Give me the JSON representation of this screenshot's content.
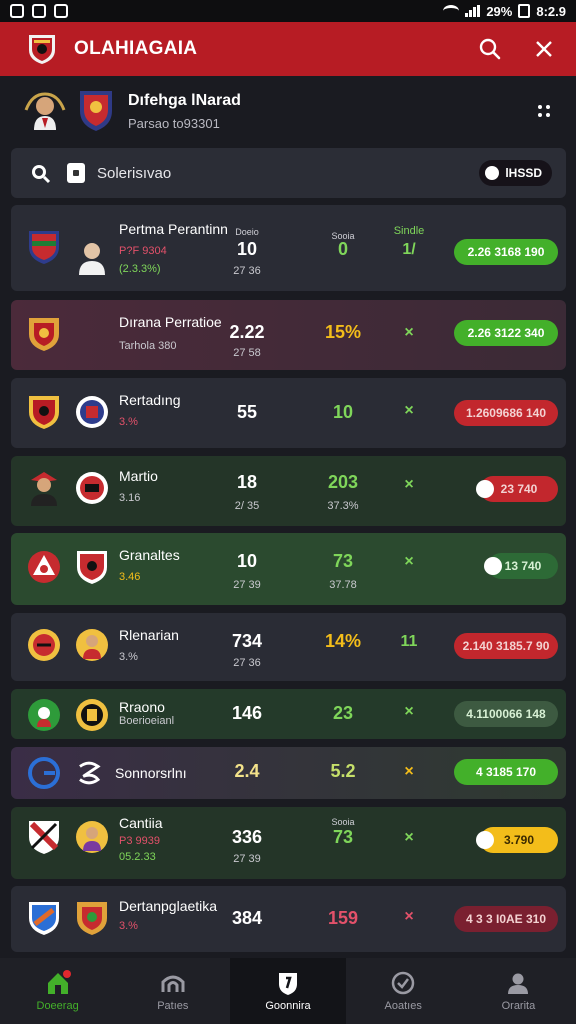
{
  "status_bar": {
    "time": "8:2.9",
    "battery": "29%"
  },
  "app_bar": {
    "title": "OLAHIAGAIA"
  },
  "profile": {
    "name": "Dıfehga lNarad",
    "subtitle": "Parsao to93301"
  },
  "search": {
    "placeholder": "Solerisıvao",
    "badge": "lHSSD"
  },
  "matches": [
    {
      "team": "Pertma Perantinn",
      "line1": "P?F 9304",
      "line2": "(2.3.3%)",
      "col1_header": "Doeio",
      "col2_header": "Sooia",
      "col3_header": "Sindle",
      "col1_value": "10",
      "col1_sub": "27 36",
      "col2_value": "0",
      "col3_value": "1/",
      "pill": "2.26 3168 190",
      "pill_style": "green"
    },
    {
      "team": "Dırana Perratioe",
      "line1": "Tarhola 380",
      "col1_value": "2.22",
      "col1_sub": "27 58",
      "col2_value": "15%",
      "col3_value": "×",
      "pill": "2.26 3122 340",
      "pill_style": "green"
    },
    {
      "team": "Rertadıng",
      "line1": "3.%",
      "col1_value": "55",
      "col2_value": "10",
      "col3_value": "×",
      "pill": "1.2609686 140",
      "pill_style": "red"
    },
    {
      "team": "Martio",
      "line1": "3.16",
      "col1_value": "18",
      "col1_sub": "2/ 35",
      "col2_value": "203",
      "col2_sub": "37.3%",
      "col3_value": "×",
      "pill": "23 740",
      "pill_style": "red"
    },
    {
      "team": "Granaltes",
      "line1": "3.46",
      "col1_value": "10",
      "col1_sub": "27 39",
      "col2_value": "73",
      "col2_sub": "37.78",
      "col3_value": "×",
      "pill": "13 740",
      "pill_style": "dark"
    },
    {
      "team": "Rlenarian",
      "line1": "3.%",
      "col1_value": "734",
      "col1_sub": "27 36",
      "col2_value": "14%",
      "col3_value": "11",
      "pill": "2.140 3185.7 90",
      "pill_style": "red"
    },
    {
      "team": "Rraono",
      "line1": "Boerioeianl",
      "col1_value": "146",
      "col2_value": "23",
      "col3_value": "×",
      "pill": "4.1100066 148",
      "pill_style": "dark"
    },
    {
      "team": "Sonnorsrlnı",
      "col1_value": "2.4",
      "col2_value": "5.2",
      "col3_value": "×",
      "pill": "4 3185 170",
      "pill_style": "green"
    },
    {
      "team": "Cantiia",
      "line1": "P3 9939",
      "line2": "05.2.33",
      "col2_header": "Sooia",
      "col1_value": "336",
      "col1_sub": "27 39",
      "col2_value": "73",
      "col3_value": "×",
      "pill": "3.790",
      "pill_style": "yellow"
    },
    {
      "team": "Dertanpglaetika",
      "line1": "3.%",
      "col1_value": "384",
      "col2_value": "159",
      "col3_value": "×",
      "pill": "4 3 3 I0AE 310",
      "pill_style": "red"
    }
  ],
  "bottom_nav": [
    {
      "label": "Doeerag"
    },
    {
      "label": "Patıes"
    },
    {
      "label": "Goonnira"
    },
    {
      "label": "Aoatıes"
    },
    {
      "label": "Orarita"
    }
  ],
  "colors": {
    "accent_red": "#b71c24",
    "green": "#43b02a",
    "yellow": "#f3bd1a",
    "background": "#1a1b21"
  }
}
